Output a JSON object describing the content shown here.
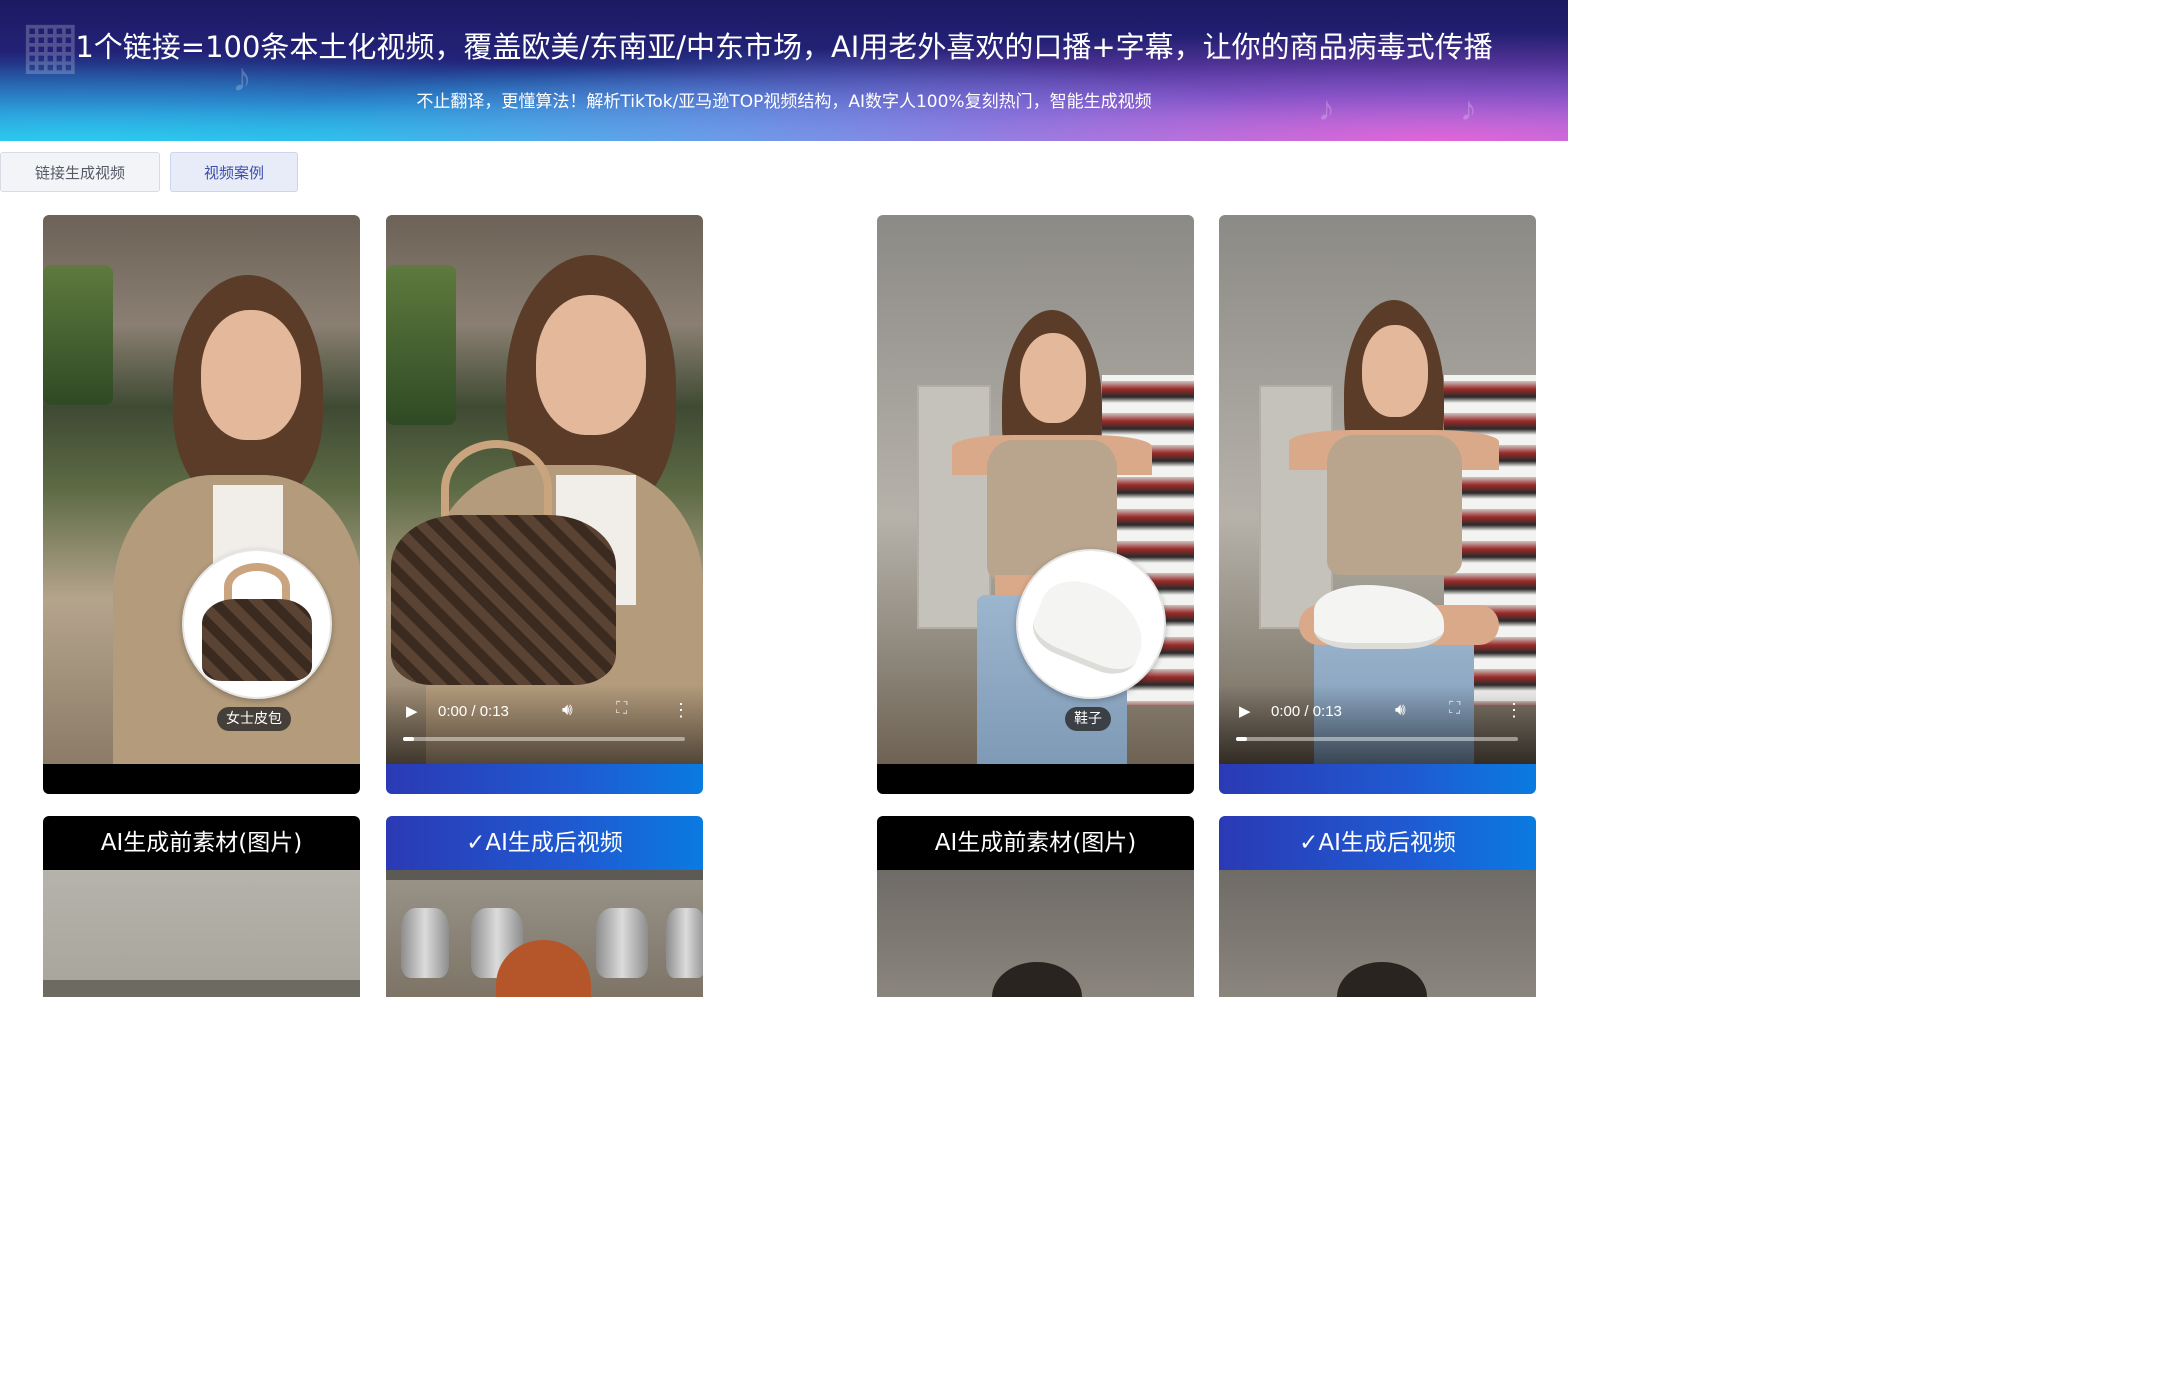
{
  "banner": {
    "title": "1个链接=100条本土化视频，覆盖欧美/东南亚/中东市场，AI用老外喜欢的口播+字幕，让你的商品病毒式传播",
    "subtitle": "不止翻译，更懂算法！解析TikTok/亚马逊TOP视频结构，AI数字人100%复刻热门，智能生成视频"
  },
  "tabs": [
    {
      "label": "链接生成视频",
      "active": false
    },
    {
      "label": "视频案例",
      "active": true
    }
  ],
  "cases": [
    {
      "product_label": "女士皮包",
      "video": {
        "time": "0:00 / 0:13",
        "progress": 0.04
      }
    },
    {
      "product_label": "鞋子",
      "video": {
        "time": "0:00 / 0:13",
        "progress": 0.04
      }
    }
  ],
  "section_labels": {
    "before": "AI生成前素材(图片)",
    "after": "✓AI生成后视频"
  },
  "icons": {
    "play": "play-icon",
    "volume": "volume-icon",
    "fullscreen": "fullscreen-icon",
    "more": "more-vertical-icon"
  },
  "colors": {
    "accent_blue": "#1f5ad2",
    "banner_dark": "#1d1a63",
    "banner_pink": "#ec60d6",
    "tab_active_text": "#3c4fa8"
  }
}
